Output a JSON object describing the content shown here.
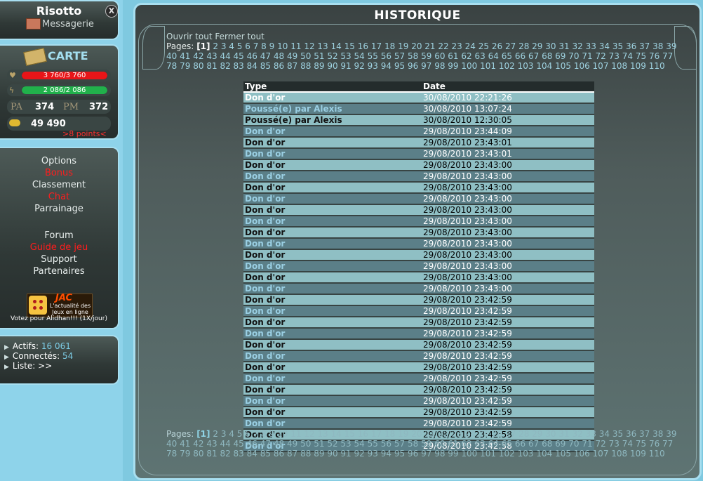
{
  "user": {
    "name": "Risotto",
    "messages_label": "Messagerie",
    "close_label": "X"
  },
  "carte": {
    "title": "CARTE",
    "hp": {
      "text": "3 760/3 760",
      "fraction": 1.0
    },
    "energy": {
      "text": "2 086/2 086",
      "fraction": 1.0
    },
    "pa_label": "PA",
    "pa_value": "374",
    "pm_label": "PM",
    "pm_value": "372",
    "gold": "49 490",
    "points": ">8 points<"
  },
  "menu": {
    "items": [
      {
        "label": "Options",
        "color": "white"
      },
      {
        "label": "Bonus",
        "color": "red"
      },
      {
        "label": "Classement",
        "color": "white"
      },
      {
        "label": "Chat",
        "color": "red"
      },
      {
        "label": "Parrainage",
        "color": "white"
      },
      {
        "label": "Forum",
        "color": "white"
      },
      {
        "label": "Guide de jeu",
        "color": "red"
      },
      {
        "label": "Support",
        "color": "white"
      },
      {
        "label": "Partenaires",
        "color": "white"
      }
    ],
    "jac_title": "JAC",
    "jac_subtitle": "L'actualité des Jeux en ligne",
    "vote": "Votez pour Alidhan!!! (1X/jour)"
  },
  "stats": {
    "actifs_label": "Actifs:",
    "actifs_value": "16 061",
    "connectes_label": "Connectés:",
    "connectes_value": "54",
    "liste_label": "Liste:",
    "liste_value": ">>"
  },
  "main": {
    "title": "HISTORIQUE",
    "open_all": "Ouvrir tout",
    "close_all": "Fermer tout",
    "pages_label": "Pages:",
    "current_page": "[1]",
    "page_count": 110,
    "columns": [
      "Type",
      "Date"
    ],
    "rows": [
      {
        "type": "Don d'or",
        "date": "30/08/2010 22:21:26"
      },
      {
        "type": "Poussé(e) par Alexis",
        "date": "30/08/2010 13:07:24"
      },
      {
        "type": "Poussé(e) par Alexis",
        "date": "30/08/2010 12:30:05"
      },
      {
        "type": "Don d'or",
        "date": "29/08/2010 23:44:09"
      },
      {
        "type": "Don d'or",
        "date": "29/08/2010 23:43:01"
      },
      {
        "type": "Don d'or",
        "date": "29/08/2010 23:43:01"
      },
      {
        "type": "Don d'or",
        "date": "29/08/2010 23:43:00"
      },
      {
        "type": "Don d'or",
        "date": "29/08/2010 23:43:00"
      },
      {
        "type": "Don d'or",
        "date": "29/08/2010 23:43:00"
      },
      {
        "type": "Don d'or",
        "date": "29/08/2010 23:43:00"
      },
      {
        "type": "Don d'or",
        "date": "29/08/2010 23:43:00"
      },
      {
        "type": "Don d'or",
        "date": "29/08/2010 23:43:00"
      },
      {
        "type": "Don d'or",
        "date": "29/08/2010 23:43:00"
      },
      {
        "type": "Don d'or",
        "date": "29/08/2010 23:43:00"
      },
      {
        "type": "Don d'or",
        "date": "29/08/2010 23:43:00"
      },
      {
        "type": "Don d'or",
        "date": "29/08/2010 23:43:00"
      },
      {
        "type": "Don d'or",
        "date": "29/08/2010 23:43:00"
      },
      {
        "type": "Don d'or",
        "date": "29/08/2010 23:43:00"
      },
      {
        "type": "Don d'or",
        "date": "29/08/2010 23:42:59"
      },
      {
        "type": "Don d'or",
        "date": "29/08/2010 23:42:59"
      },
      {
        "type": "Don d'or",
        "date": "29/08/2010 23:42:59"
      },
      {
        "type": "Don d'or",
        "date": "29/08/2010 23:42:59"
      },
      {
        "type": "Don d'or",
        "date": "29/08/2010 23:42:59"
      },
      {
        "type": "Don d'or",
        "date": "29/08/2010 23:42:59"
      },
      {
        "type": "Don d'or",
        "date": "29/08/2010 23:42:59"
      },
      {
        "type": "Don d'or",
        "date": "29/08/2010 23:42:59"
      },
      {
        "type": "Don d'or",
        "date": "29/08/2010 23:42:59"
      },
      {
        "type": "Don d'or",
        "date": "29/08/2010 23:42:59"
      },
      {
        "type": "Don d'or",
        "date": "29/08/2010 23:42:59"
      },
      {
        "type": "Don d'or",
        "date": "29/08/2010 23:42:59"
      },
      {
        "type": "Don d'or",
        "date": "29/08/2010 23:42:58"
      },
      {
        "type": "Don d'or",
        "date": "29/08/2010 23:42:58"
      }
    ]
  }
}
